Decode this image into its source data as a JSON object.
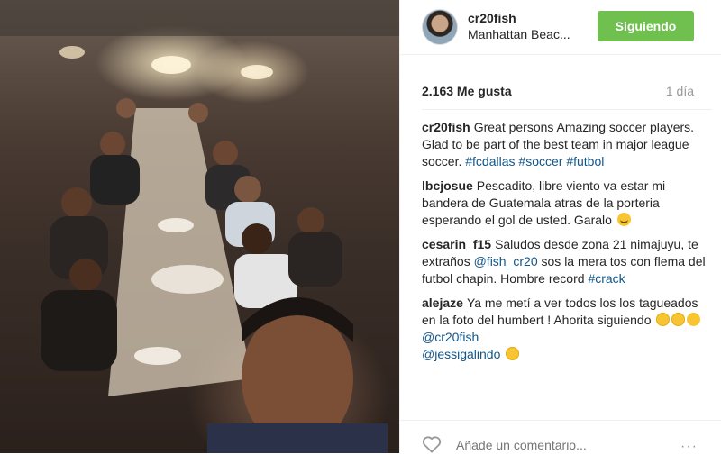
{
  "header": {
    "username": "cr20fish",
    "location": "Manhattan Beac...",
    "follow_label": "Siguiendo"
  },
  "post": {
    "likes": "2.163 Me gusta",
    "time": "1 día"
  },
  "comments": [
    {
      "user": "cr20fish",
      "parts": [
        "Great persons Amazing soccer players. Glad to be part of the best team in major league soccer. ",
        "#fcdallas",
        " ",
        "#soccer",
        " ",
        "#futbol"
      ]
    },
    {
      "user": "lbcjosue",
      "parts": [
        "Pescadito, libre viento va estar mi bandera de Guatemala atras de la porteria esperando el gol de usted. Garalo"
      ]
    },
    {
      "user": "cesarin_f15",
      "parts": [
        "Saludos desde zona 21 nimajuyu, te extraños ",
        "@fish_cr20",
        " sos la mera tos con flema del futbol chapin. Hombre record ",
        "#crack"
      ]
    },
    {
      "user": "alejaze",
      "parts": [
        "Ya me metí a ver todos los los tagueados en la foto del humbert ! Ahorita siguiendo",
        "@cr20fish",
        "@jessigalindo"
      ]
    }
  ],
  "footer": {
    "comment_placeholder": "Añade un comentario...",
    "more_label": "···"
  },
  "colors": {
    "follow_button": "#70c050",
    "link": "#125688",
    "muted": "#999999"
  },
  "icons": {
    "like": "heart-outline-icon",
    "emoji": "smiley-emoji-icon"
  }
}
